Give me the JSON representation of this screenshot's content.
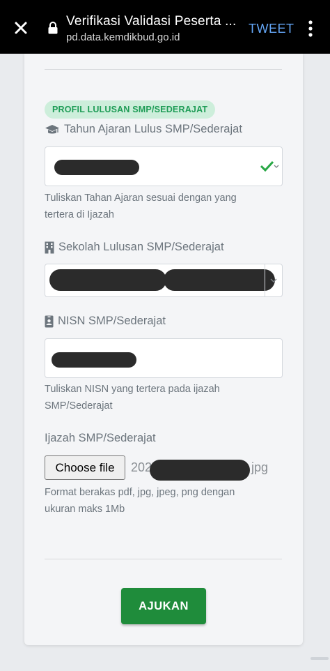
{
  "browser": {
    "title": "Verifikasi Validasi Peserta ...",
    "url": "pd.data.kemdikbud.go.id",
    "action_label": "TWEET",
    "icons": {
      "close": "close-icon",
      "lock": "lock-icon",
      "menu": "kebab-menu-icon"
    }
  },
  "form": {
    "section_badge": "PROFIL LULUSAN SMP/SEDERAJAT",
    "tahun_ajaran": {
      "label": "Tahun Ajaran Lulus SMP/Sederajat",
      "icon": "graduation-cap-icon",
      "help": "Tuliskan Tahan Ajaran sesuai dengan yang tertera di Ijazah",
      "valid": true
    },
    "sekolah": {
      "label": "Sekolah Lulusan SMP/Sederajat",
      "icon": "building-icon"
    },
    "nisn": {
      "label": "NISN SMP/Sederajat",
      "icon": "id-badge-icon",
      "help": "Tuliskan NISN yang tertera pada ijazah SMP/Sederajat"
    },
    "ijazah": {
      "label": "Ijazah SMP/Sederajat",
      "choose_label": "Choose file",
      "file_prefix": "202",
      "file_suffix": "jpg",
      "help": "Format berakas pdf, jpg, jpeg, png dengan ukuran maks 1Mb"
    },
    "submit_label": "AJUKAN"
  },
  "colors": {
    "accent_green": "#1f8c3b",
    "badge_bg": "#cdeedb",
    "badge_text": "#1e9c56",
    "tweet_blue": "#64a6f6"
  }
}
